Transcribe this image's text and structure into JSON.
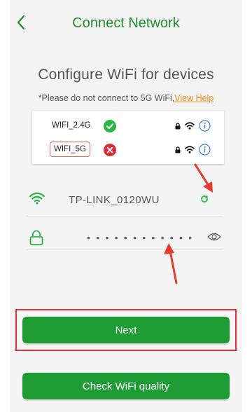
{
  "header": {
    "title": "Connect Network",
    "back_icon": "chevron-left-icon"
  },
  "configure": {
    "title": "Configure WiFi for devices",
    "note": "*Please do not connect to 5G WiFi,",
    "help_link": "View Help"
  },
  "wifi_bands": [
    {
      "label": "WIFI_2.4G",
      "status": "supported",
      "status_icon": "check-circle-icon",
      "status_color": "#2ab546"
    },
    {
      "label": "WIFI_5G",
      "status": "unsupported",
      "status_icon": "x-circle-icon",
      "status_color": "#dd2d3a"
    }
  ],
  "network": {
    "ssid": "TP-LINK_0120WU",
    "password_mask": "••••••••••••"
  },
  "buttons": {
    "next": "Next",
    "check_quality": "Check WiFi quality"
  },
  "colors": {
    "accent_green": "#1f9c36",
    "title_green": "#1e8f2e",
    "link_orange": "#f08a1a",
    "highlight_red": "#e0333b"
  }
}
